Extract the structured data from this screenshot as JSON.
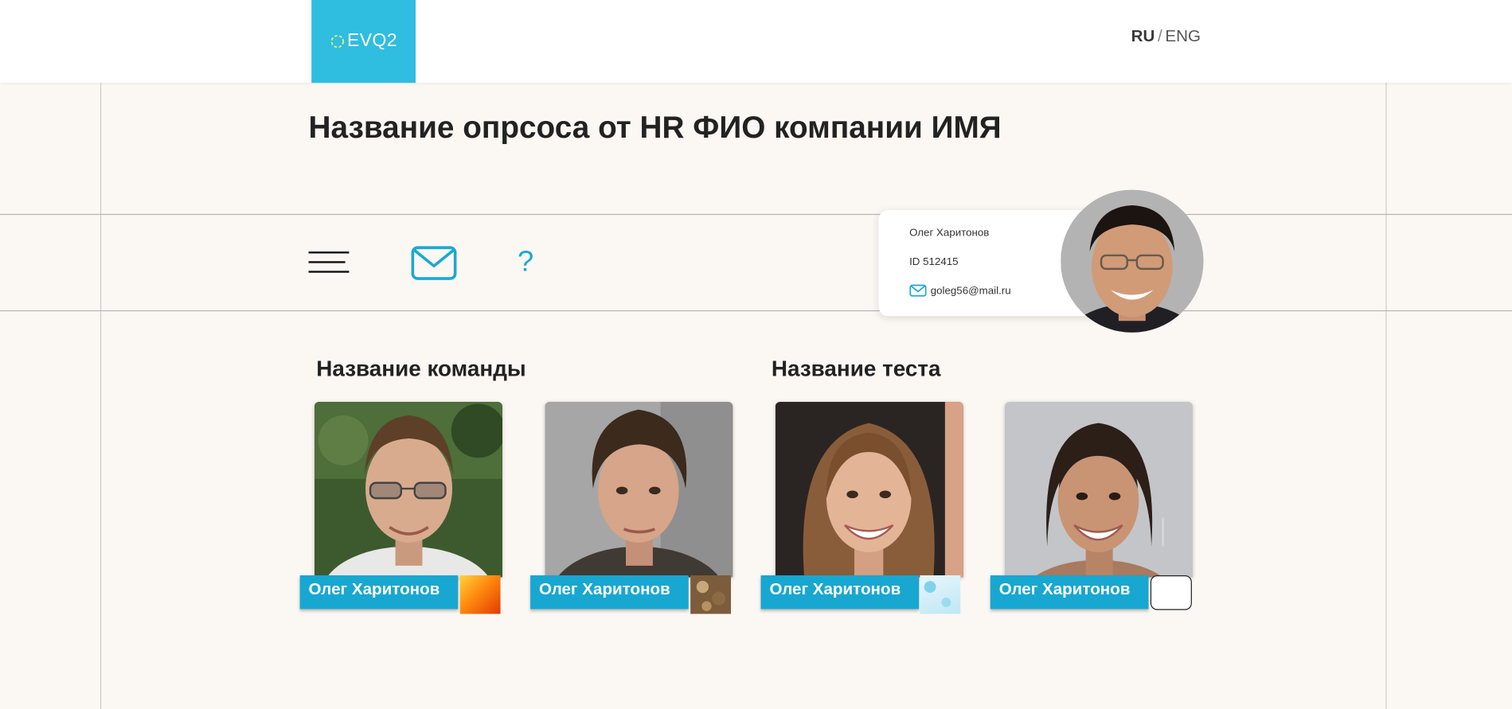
{
  "header": {
    "logo_text": "EVQ2",
    "lang_active": "RU",
    "lang_separator": "/",
    "lang_inactive": "ENG"
  },
  "page_title": "Название опрсоса от HR ФИО компании ИМЯ",
  "toolbar": {
    "menu_icon": "hamburger-menu-icon",
    "mail_icon": "envelope-icon",
    "help_label": "?"
  },
  "profile": {
    "name": "Олег Харитонов",
    "id": "ID 512415",
    "email": "goleg56@mail.ru"
  },
  "sections": {
    "team_title": "Название команды",
    "test_title": "Название теста"
  },
  "members": [
    {
      "name": "Олег Харитонов",
      "swatch": "orange-flame"
    },
    {
      "name": "Олег Харитонов",
      "swatch": "brown-texture"
    },
    {
      "name": "Олег Харитонов",
      "swatch": "water-drops"
    },
    {
      "name": "Олег Харитонов",
      "swatch": "white"
    }
  ],
  "colors": {
    "accent": "#17a7d1",
    "logo_bg": "#2fbde0",
    "page_bg": "#fbf7f3"
  }
}
